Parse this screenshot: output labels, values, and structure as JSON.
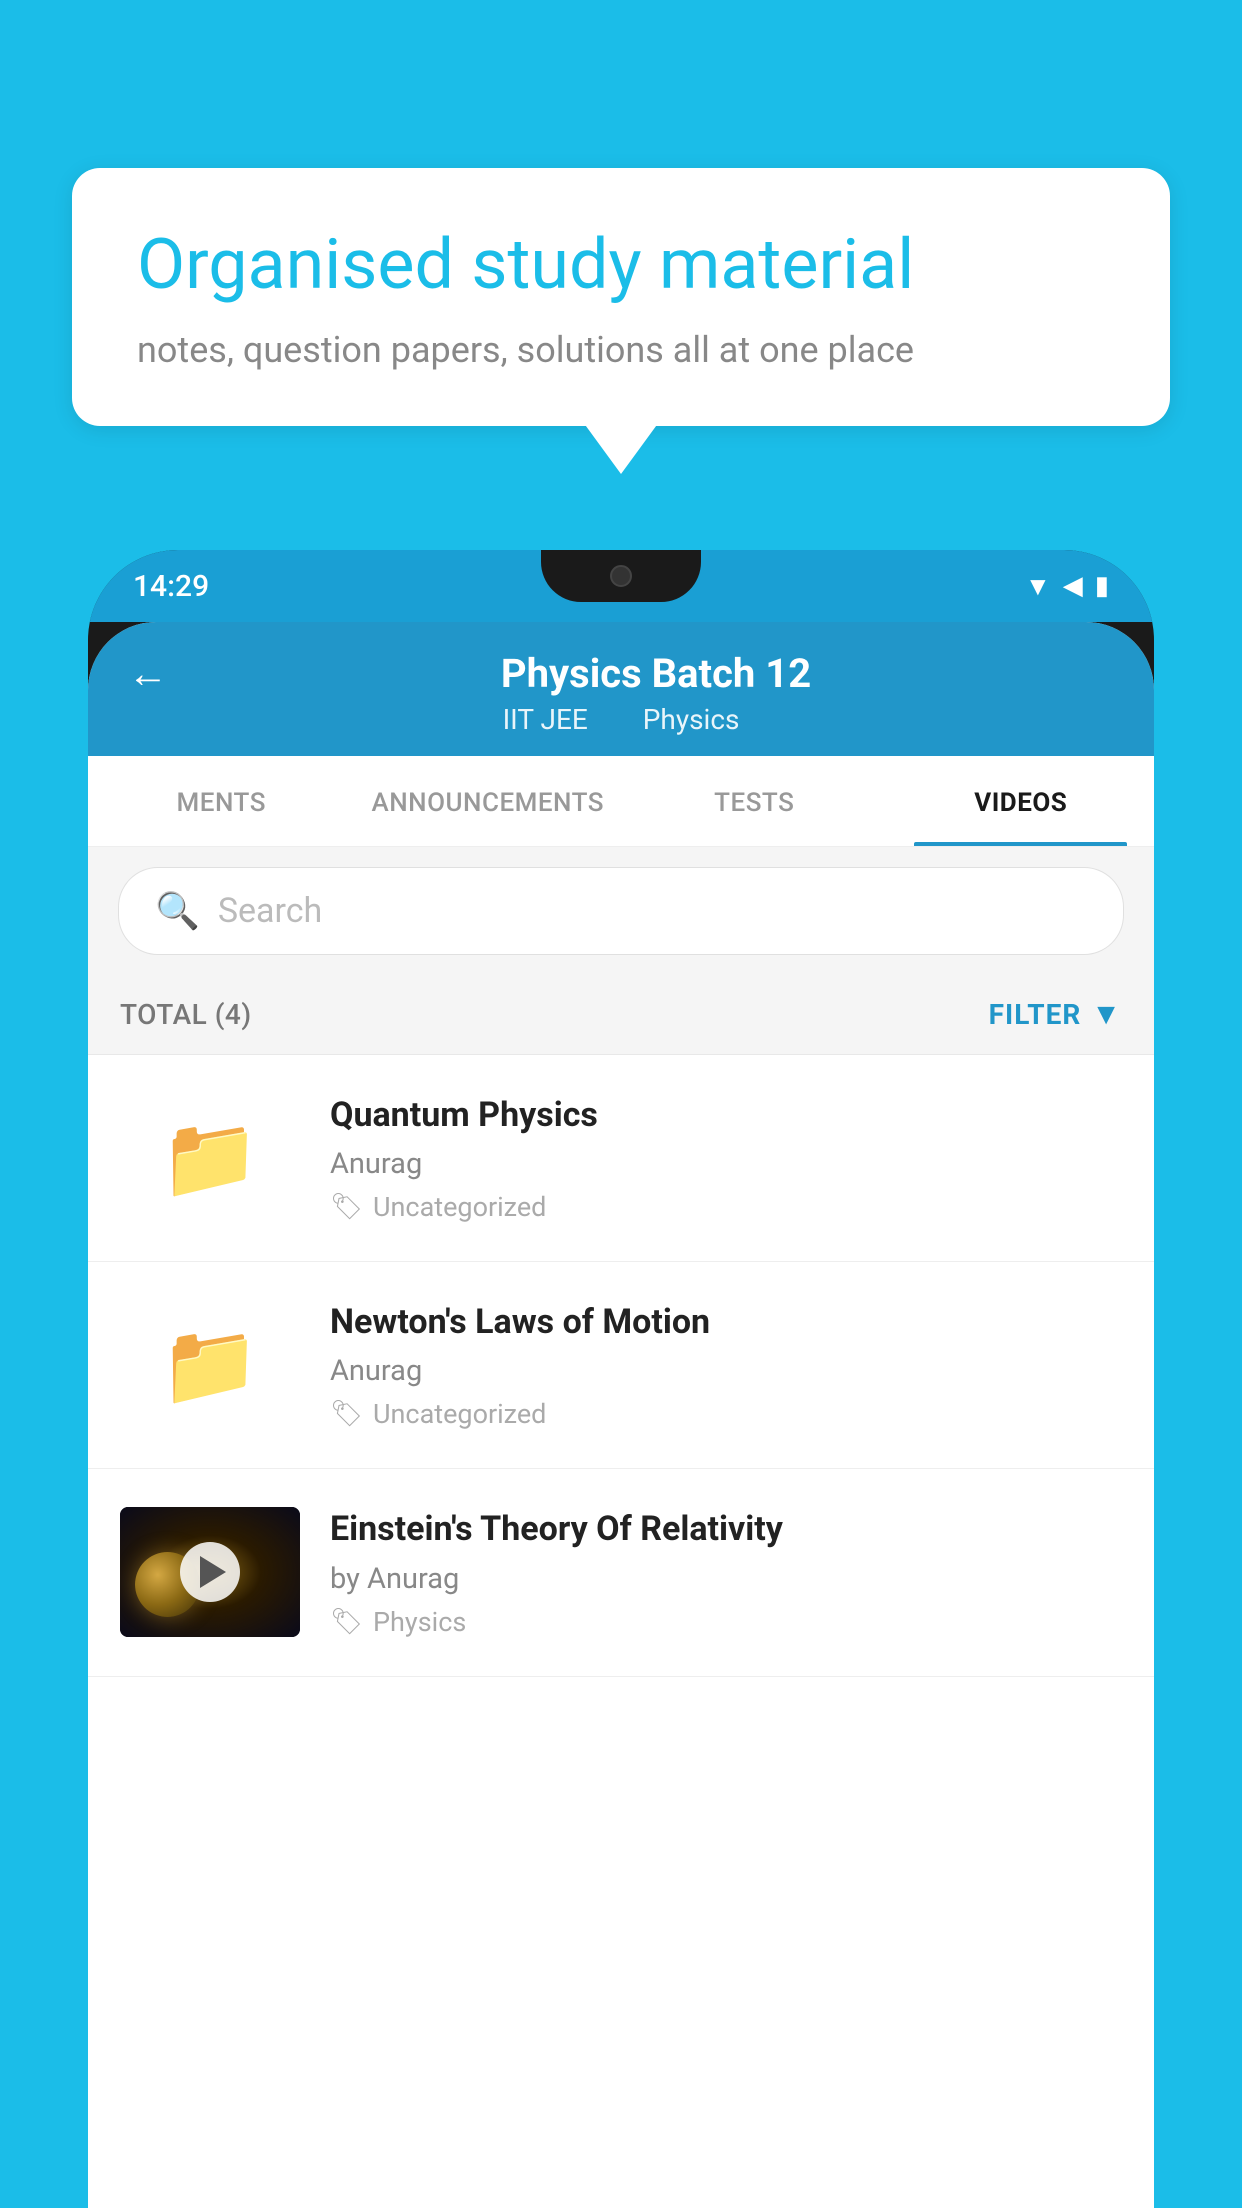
{
  "background_color": "#1BBDE8",
  "speech_bubble": {
    "title": "Organised study material",
    "subtitle": "notes, question papers, solutions all at one place"
  },
  "phone": {
    "status_bar": {
      "time": "14:29",
      "icons": [
        "▼",
        "◀",
        "▮"
      ]
    },
    "header": {
      "back_label": "←",
      "title": "Physics Batch 12",
      "subtitle_parts": [
        "IIT JEE",
        "Physics"
      ]
    },
    "tabs": [
      {
        "label": "MENTS",
        "active": false
      },
      {
        "label": "ANNOUNCEMENTS",
        "active": false
      },
      {
        "label": "TESTS",
        "active": false
      },
      {
        "label": "VIDEOS",
        "active": true
      }
    ],
    "search": {
      "placeholder": "Search"
    },
    "filter": {
      "total_label": "TOTAL (4)",
      "filter_label": "FILTER"
    },
    "videos": [
      {
        "id": 1,
        "title": "Quantum Physics",
        "author": "Anurag",
        "tag": "Uncategorized",
        "has_thumb": false
      },
      {
        "id": 2,
        "title": "Newton's Laws of Motion",
        "author": "Anurag",
        "tag": "Uncategorized",
        "has_thumb": false
      },
      {
        "id": 3,
        "title": "Einstein's Theory Of Relativity",
        "author": "by Anurag",
        "tag": "Physics",
        "has_thumb": true
      }
    ]
  }
}
